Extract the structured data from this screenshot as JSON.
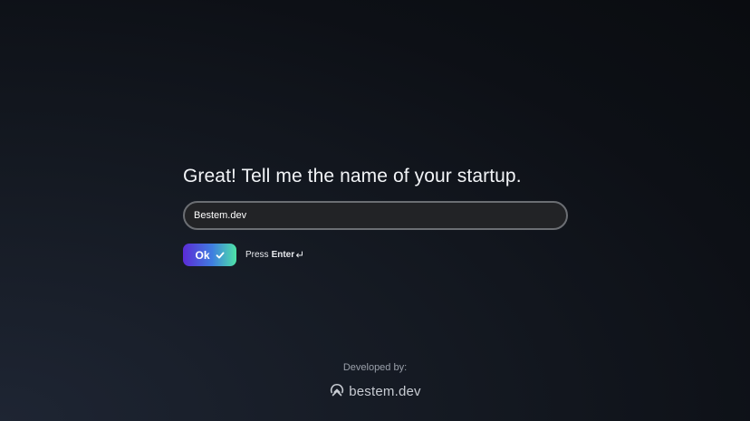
{
  "form": {
    "question": "Great! Tell me the name of your startup.",
    "input_value": "Bestem.dev",
    "ok_label": "Ok",
    "hint_prefix": "Press",
    "hint_key": "Enter"
  },
  "footer": {
    "label": "Developed by:",
    "brand": "bestem.dev"
  },
  "icons": {
    "ok": "checkmark-icon",
    "enter": "enter-key-icon",
    "brand": "bestem-logo-icon"
  },
  "colors": {
    "accent_start": "#5b2bd6",
    "accent_end": "#4ee3a7"
  }
}
